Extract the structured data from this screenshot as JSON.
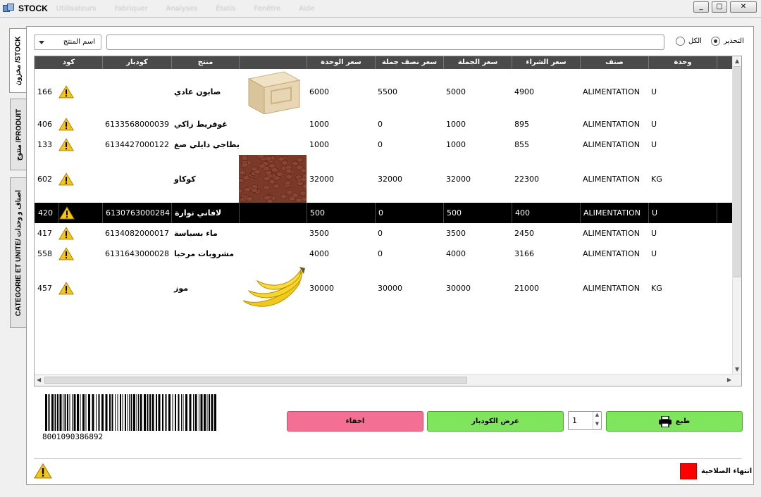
{
  "window": {
    "title": "STOCK",
    "menu": [
      "Utilisateurs",
      "Fabriquer",
      "Analyses",
      "Étatis",
      "Fenêtre",
      "Aide"
    ],
    "minimize_glyph": "_",
    "maximize_glyph": "□",
    "close_glyph": "✕"
  },
  "tabs": [
    {
      "label": "مخزون /STOCK",
      "active": true
    },
    {
      "label": "منتوج /PRODUIT",
      "active": false
    },
    {
      "label": "CATEGORIE ET UNITE/ اصناف و وحدات",
      "active": false
    }
  ],
  "filter": {
    "field_select": "اسم المنتج",
    "radio_all_label": "الكل",
    "radio_warning_label": "التحذير",
    "selected": "warning",
    "search_value": ""
  },
  "grid": {
    "columns": [
      "كود",
      "",
      "كودبار",
      "منتج",
      "",
      "سعر الوحدة",
      "سعر نصف جملة",
      "سعر الجملة",
      "سعر الشراء",
      "صنف",
      "وحدة"
    ],
    "rows": [
      {
        "code": "166",
        "warning": true,
        "barcode": "",
        "product": "صابون عادي",
        "image": "soap-image",
        "unit_price": "6000",
        "half_wholesale": "5500",
        "wholesale": "5000",
        "purchase": "4900",
        "category": "ALIMENTATION",
        "unit": "U",
        "selected": false
      },
      {
        "code": "406",
        "warning": true,
        "barcode": "6133568000039",
        "product": "غوفريط زاكي",
        "image": "",
        "unit_price": "1000",
        "half_wholesale": "0",
        "wholesale": "1000",
        "purchase": "895",
        "category": "ALIMENTATION",
        "unit": "U",
        "selected": false
      },
      {
        "code": "133",
        "warning": true,
        "barcode": "6134427000122",
        "product": "...فيطاجي دايلي صغ",
        "image": "",
        "unit_price": "1000",
        "half_wholesale": "0",
        "wholesale": "1000",
        "purchase": "855",
        "category": "ALIMENTATION",
        "unit": "U",
        "selected": false
      },
      {
        "code": "602",
        "warning": true,
        "barcode": "",
        "product": "كوكاو",
        "image": "peanuts-image",
        "unit_price": "32000",
        "half_wholesale": "32000",
        "wholesale": "32000",
        "purchase": "22300",
        "category": "ALIMENTATION",
        "unit": "KG",
        "selected": false
      },
      {
        "code": "420",
        "warning": true,
        "barcode": "6130763000284",
        "product": "لافاني نوارة",
        "image": "",
        "unit_price": "500",
        "half_wholesale": "0",
        "wholesale": "500",
        "purchase": "400",
        "category": "ALIMENTATION",
        "unit": "U",
        "selected": true
      },
      {
        "code": "417",
        "warning": true,
        "barcode": "6134082000017",
        "product": "ماء بسباسة",
        "image": "",
        "unit_price": "3500",
        "half_wholesale": "0",
        "wholesale": "3500",
        "purchase": "2450",
        "category": "ALIMENTATION",
        "unit": "U",
        "selected": false
      },
      {
        "code": "558",
        "warning": true,
        "barcode": "6131643000028",
        "product": "مشروبات مرحبا",
        "image": "",
        "unit_price": "4000",
        "half_wholesale": "0",
        "wholesale": "4000",
        "purchase": "3166",
        "category": "ALIMENTATION",
        "unit": "U",
        "selected": false
      },
      {
        "code": "457",
        "warning": true,
        "barcode": "",
        "product": "موز",
        "image": "bananas-image",
        "unit_price": "30000",
        "half_wholesale": "30000",
        "wholesale": "30000",
        "purchase": "21000",
        "category": "ALIMENTATION",
        "unit": "KG",
        "selected": false
      }
    ]
  },
  "barcode": {
    "number": "8001090386892"
  },
  "actions": {
    "hide_label": "اخفاء",
    "show_barcode_label": "عرض الكودبار",
    "quantity": "1",
    "print_label": "طبع"
  },
  "legend": {
    "expiry_label": "انتهاء الصلاحية",
    "expiry_color": "#ff0000",
    "warning_color": "#f5c518"
  }
}
